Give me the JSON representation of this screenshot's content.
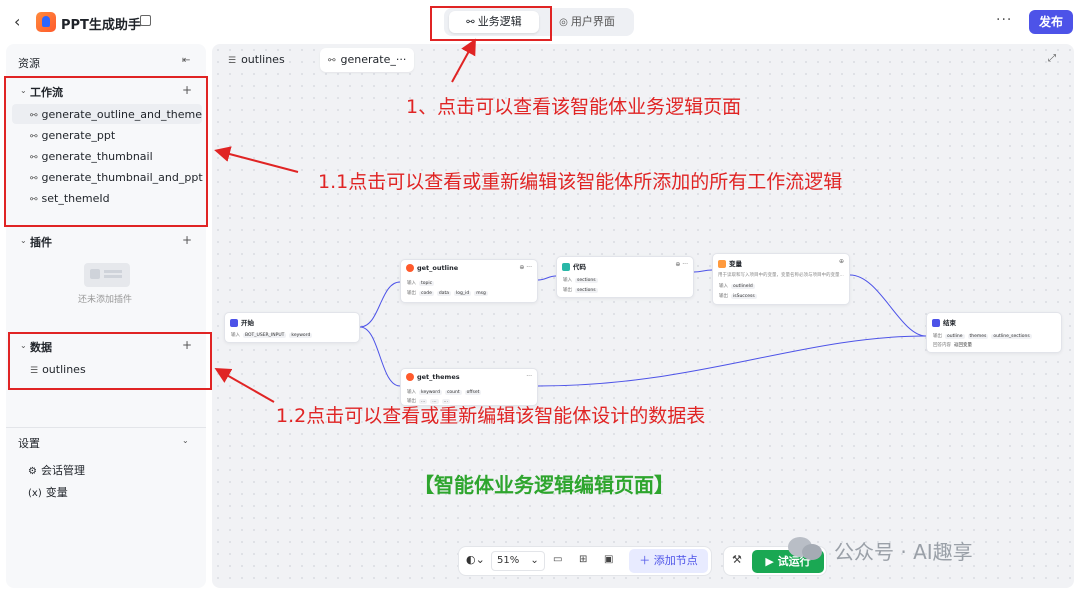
{
  "header": {
    "back_icon": "chevron-left-icon",
    "app_title": "PPT生成助手",
    "segments": [
      {
        "label": "业务逻辑",
        "icon": "flow-icon",
        "active": true
      },
      {
        "label": "用户界面",
        "icon": "palette-icon",
        "active": false
      }
    ],
    "more": "···",
    "publish_label": "发布"
  },
  "sidebar": {
    "title": "资源",
    "workflow_section": {
      "title": "工作流",
      "items": [
        "generate_outline_and_theme",
        "generate_ppt",
        "generate_thumbnail",
        "generate_thumbnail_and_ppt",
        "set_themeId"
      ]
    },
    "plugin_section": {
      "title": "插件",
      "empty_text": "还未添加插件"
    },
    "data_section": {
      "title": "数据",
      "items": [
        "outlines"
      ]
    },
    "settings_section": {
      "title": "设置",
      "items": [
        {
          "label": "会话管理",
          "icon": "chat-settings-icon"
        },
        {
          "label": "变量",
          "icon": "variable-icon"
        }
      ]
    }
  },
  "canvas": {
    "tabs": [
      {
        "label": "outlines",
        "icon": "database-icon"
      },
      {
        "label": "generate_···",
        "icon": "workflow-icon"
      }
    ],
    "nodes": {
      "start": {
        "title": "开始",
        "row1_label": "输入",
        "params": [
          "BOT_USER_INPUT",
          "keyword"
        ]
      },
      "get_outline": {
        "title": "get_outline",
        "in_label": "输入",
        "inputs": [
          "topic"
        ],
        "out_label": "输出",
        "outputs": [
          "code",
          "data",
          "log_id",
          "msg"
        ]
      },
      "code": {
        "title": "代码",
        "in_label": "输入",
        "inputs": [
          "sections"
        ],
        "out_label": "输出",
        "outputs": [
          "sections"
        ]
      },
      "variable": {
        "title": "变量",
        "desc": "用于读取和写入项目中的变量，变量名称必须与项目中的变量...",
        "in_label": "输入",
        "inputs": [
          "outlineId"
        ],
        "out_label": "输出",
        "outputs": [
          "isSuccess"
        ]
      },
      "get_themes": {
        "title": "get_themes",
        "in_label": "输入",
        "inputs": [
          "keyword",
          "count",
          "offset"
        ],
        "out_label": "输出",
        "outputs": [
          "...",
          "...",
          "..."
        ]
      },
      "end": {
        "title": "结束",
        "in_label": "输出",
        "outputs": [
          "outline",
          "themes",
          "outline_sections"
        ],
        "mode_label": "回答内容",
        "mode_value": "返回变量"
      }
    }
  },
  "toolbar": {
    "zoom": "51%",
    "add_node_label": "添加节点",
    "run_label": "试运行"
  },
  "annotations": {
    "a1": "1、点击可以查看该智能体业务逻辑页面",
    "a11": "1.1点击可以查看或重新编辑该智能体所添加的所有工作流逻辑",
    "a12": "1.2点击可以查看或重新编辑该智能体设计的数据表",
    "caption": "【智能体业务逻辑编辑页面】",
    "color": "#e02424",
    "caption_color": "#2ea52e"
  },
  "watermark": "公众号 · AI趣享"
}
